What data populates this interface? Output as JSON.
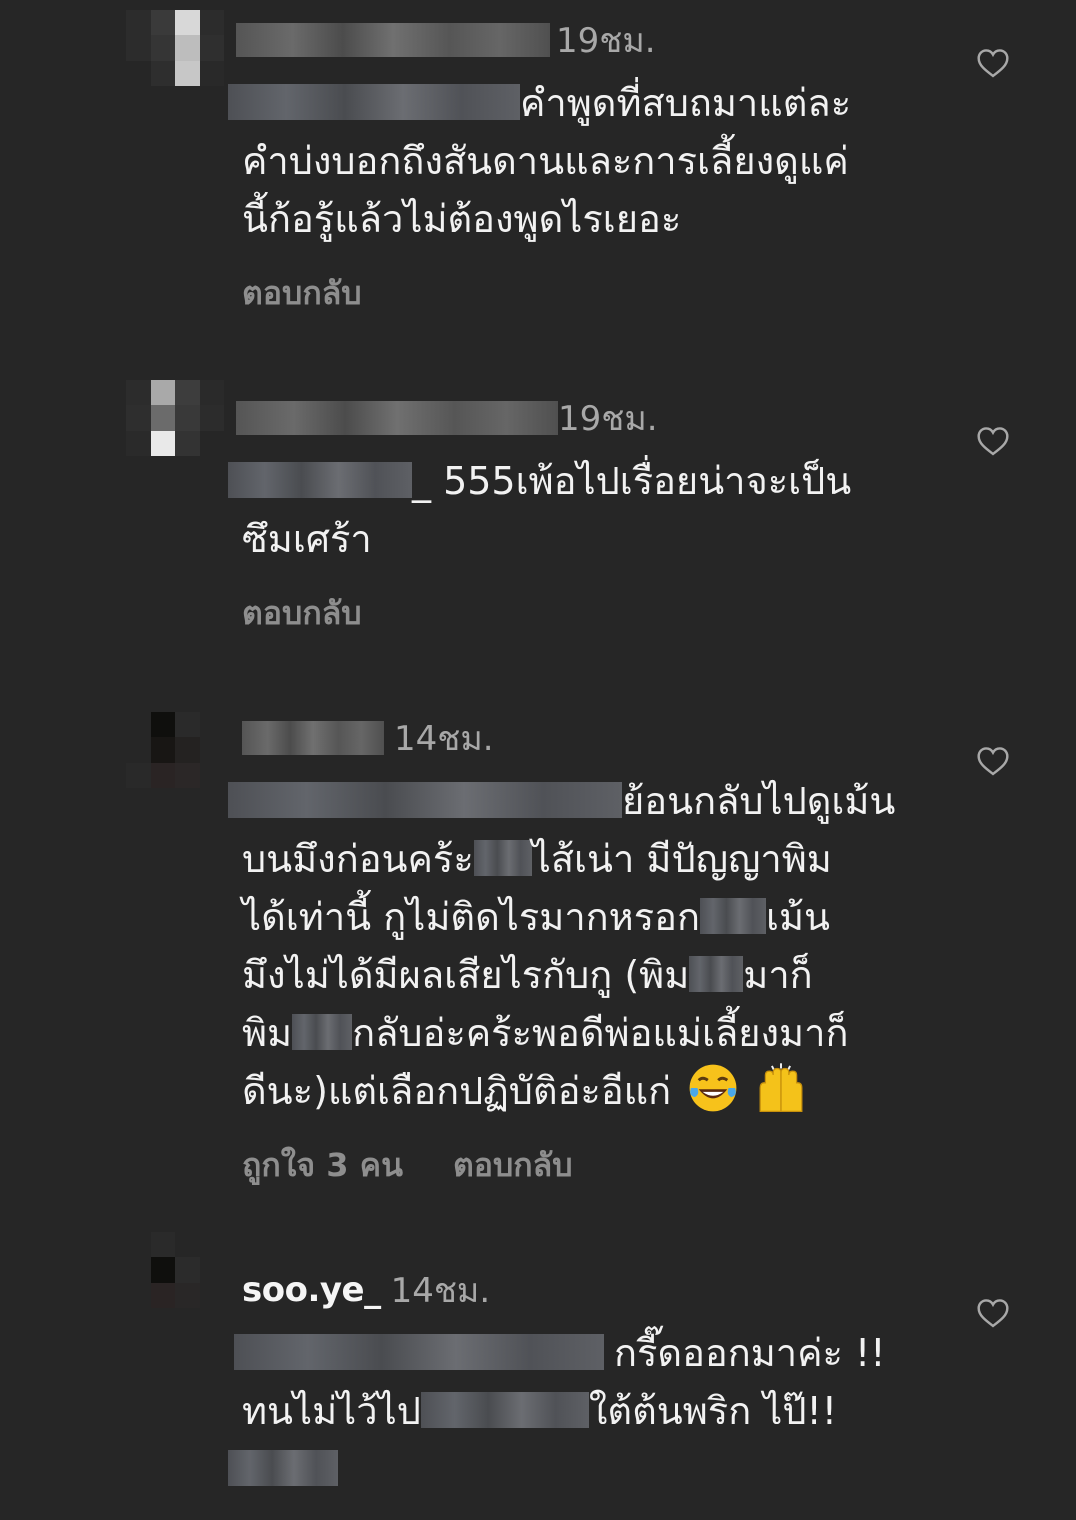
{
  "comments": [
    {
      "username": "",
      "time": "19ชม.",
      "lines": [
        {
          "mask_before": true,
          "text": "คำพูดที่สบถมาแต่ละ"
        },
        {
          "text": "คำบ่งบอกถึงสันดานและการเลี้ยงดูแค่"
        },
        {
          "text": "นี้ก้อรู้แล้วไม่ต้องพูดไรเยอะ"
        }
      ],
      "reply_label": "ตอบกลับ",
      "like_icon": "heart-outline-icon"
    },
    {
      "username": "",
      "time": "19ชม.",
      "lines": [
        {
          "mask_before": true,
          "text": "_ 555เพ้อไปเรื่อยน่าจะเป็น"
        },
        {
          "text": "ซึมเศร้า"
        }
      ],
      "reply_label": "ตอบกลับ",
      "like_icon": "heart-outline-icon"
    },
    {
      "username": "",
      "time": "14ชม.",
      "lines": [
        {
          "mask_before": true,
          "text": "ย้อนกลับไปดูเม้น"
        },
        {
          "text_a": "บนมึงก่อนคร้ะ",
          "text_b": "ไส้เน่า มีปัญญาพิม"
        },
        {
          "text_a": "ได้เท่านี้ กูไม่ติดไรมากหรอก",
          "text_b": "เม้น"
        },
        {
          "text_a": "มึงไม่ได้มีผลเสียไรกับกู (พิม",
          "text_b": "มาก็"
        },
        {
          "text_a": "พิม",
          "text_b": "กลับอ่ะคร้ะพอดีพ่อแม่เลี้ยงมาก็"
        },
        {
          "text": "ดีนะ)แต่เลือกปฏิบัติอ่ะอีแก่"
        }
      ],
      "emojis": [
        "laughing-tears-emoji",
        "raised-hands-emoji"
      ],
      "likes_label": "ถูกใจ 3 คน",
      "reply_label": "ตอบกลับ",
      "like_icon": "heart-outline-icon"
    },
    {
      "username": "soo.ye_",
      "time": "14ชม.",
      "lines": [
        {
          "mask_before": true,
          "text": "กรี๊ดออกมาค่ะ !!"
        },
        {
          "text_a": "ทนไม่ไว้ไป",
          "text_b": "ใต้ต้นพริก ไป๊!!"
        },
        {
          "mask_only": true
        }
      ],
      "like_icon": "heart-outline-icon"
    }
  ],
  "colors": {
    "background": "#262626",
    "text": "#f2f2f2",
    "secondary": "#8e8e8e",
    "timestamp": "#a8a8a8"
  }
}
